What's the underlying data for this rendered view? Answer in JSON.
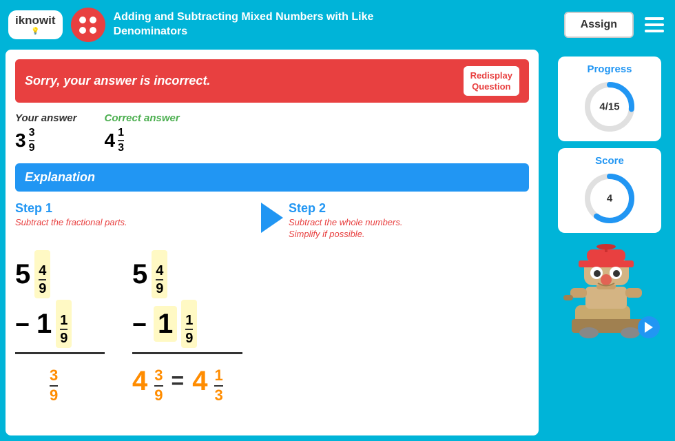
{
  "header": {
    "title_line1": "Adding and Subtracting Mixed Numbers with Like",
    "title_line2": "Denominators",
    "assign_label": "Assign"
  },
  "feedback": {
    "incorrect_message": "Sorry, your answer is incorrect.",
    "redisplay_label": "Redisplay\nQuestion"
  },
  "your_answer": {
    "label": "Your answer",
    "whole": "3",
    "numerator": "3",
    "denominator": "9"
  },
  "correct_answer": {
    "label": "Correct answer",
    "whole": "4",
    "numerator": "1",
    "denominator": "3"
  },
  "explanation": {
    "label": "Explanation",
    "step1_title": "Step 1",
    "step1_desc": "Subtract the fractional parts.",
    "step2_title": "Step 2",
    "step2_desc": "Subtract the whole numbers.\nSimplify if possible."
  },
  "math": {
    "minuend_whole": "5",
    "minuend_num": "4",
    "minuend_den": "9",
    "subtrahend_whole": "1",
    "subtrahend_num": "1",
    "subtrahend_den": "9",
    "result_num": "3",
    "result_den": "9",
    "result_whole2": "4",
    "result_num2": "3",
    "result_den2": "9",
    "simplified_whole": "4",
    "simplified_num": "1",
    "simplified_den": "3"
  },
  "progress": {
    "label": "Progress",
    "value": "4/15",
    "current": 4,
    "total": 15
  },
  "score": {
    "label": "Score",
    "value": "4"
  },
  "colors": {
    "accent": "#2196f3",
    "red": "#e84040",
    "green": "#4caf50",
    "orange": "#ff8c00"
  }
}
